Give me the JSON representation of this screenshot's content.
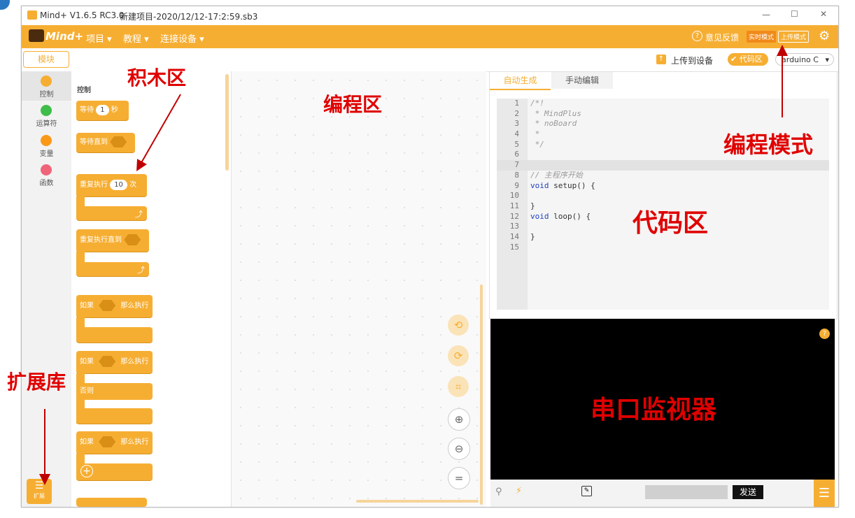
{
  "window": {
    "app_title": "Mind+ V1.6.5 RC3.0",
    "file_title": "新建项目-2020/12/12-17:2:59.sb3",
    "controls": [
      "—",
      "☐",
      "✕"
    ]
  },
  "menubar": {
    "logo_text": "Mind+",
    "items": [
      {
        "label": "项目 ▾"
      },
      {
        "label": "教程 ▾"
      },
      {
        "label": "连接设备 ▾"
      }
    ],
    "feedback": "意见反馈",
    "mode_realtime": "实时模式",
    "mode_upload": "上传模式"
  },
  "toolbar": {
    "blocks_tab": "模块",
    "upload_button": "上传到设备",
    "code_toggle": "代码区",
    "board_select": "arduino C"
  },
  "categories": [
    {
      "label": "控制",
      "color": "#f6ae32"
    },
    {
      "label": "运算符",
      "color": "#3fbd4a"
    },
    {
      "label": "变量",
      "color": "#fa9918"
    },
    {
      "label": "函数",
      "color": "#f0647a"
    }
  ],
  "palette": {
    "section_title": "控制",
    "wait": {
      "prefix": "等待",
      "value": "1",
      "suffix": "秒"
    },
    "wait_until": "等待直到",
    "repeat": {
      "prefix": "重复执行",
      "value": "10",
      "suffix": "次"
    },
    "repeat_until": "重复执行直到",
    "if_then_1": {
      "prefix": "如果",
      "suffix": "那么执行"
    },
    "if_else": {
      "prefix": "如果",
      "suffix": "那么执行",
      "else": "否则"
    },
    "if_then_2": {
      "prefix": "如果",
      "suffix": "那么执行"
    }
  },
  "extension": {
    "label": "扩展"
  },
  "code_tabs": {
    "auto": "自动生成",
    "manual": "手动编辑"
  },
  "code_lines": [
    {
      "n": "1",
      "text": "/*!"
    },
    {
      "n": "2",
      "text": " * MindPlus"
    },
    {
      "n": "3",
      "text": " * noBoard"
    },
    {
      "n": "4",
      "text": " *"
    },
    {
      "n": "5",
      "text": " */"
    },
    {
      "n": "6",
      "text": ""
    },
    {
      "n": "7",
      "text": ""
    },
    {
      "n": "8",
      "text": "// 主程序开始"
    },
    {
      "n": "9",
      "text": "void setup() {"
    },
    {
      "n": "10",
      "text": ""
    },
    {
      "n": "11",
      "text": "}"
    },
    {
      "n": "12",
      "text": "void loop() {"
    },
    {
      "n": "13",
      "text": ""
    },
    {
      "n": "14",
      "text": "}"
    },
    {
      "n": "15",
      "text": ""
    }
  ],
  "serial": {
    "send_button": "发送",
    "help": "?"
  },
  "annotations": {
    "blocks_area": "积木区",
    "programming_area": "编程区",
    "programming_mode": "编程模式",
    "code_area": "代码区",
    "extension_lib": "扩展库",
    "serial_monitor": "串口监视器"
  },
  "colors": {
    "accent": "#f6ae32",
    "annotation": "#e00000"
  }
}
